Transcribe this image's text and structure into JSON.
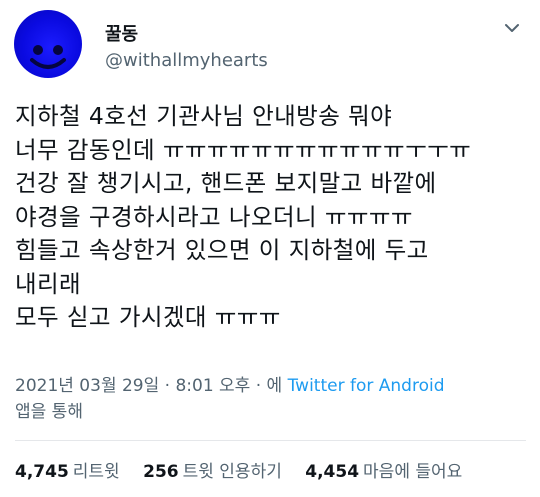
{
  "user": {
    "display_name": "꿀동",
    "handle": "@withallmyhearts"
  },
  "icons": {
    "avatar": "blue-smiley-avatar",
    "more": "chevron-down-icon"
  },
  "tweet": {
    "lines": [
      "지하철 4호선 기관사님  안내방송 뭐야",
      "너무 감동인데 ㅠㅠㅠㅠㅠㅠㅠㅠㅠㅠㅠㅜㅜㅠ",
      "건강 잘 챙기시고, 핸드폰 보지말고 바깥에",
      "야경을 구경하시라고 나오더니 ㅠㅠㅠㅠ",
      "힘들고 속상한거 있으면 이 지하철에 두고",
      "내리래",
      "모두 싣고  가시겠대 ㅠㅠㅠ"
    ]
  },
  "meta": {
    "timestamp": "2021년 03월 29일 · 8:01 오후 · 에 ",
    "source": "Twitter for Android",
    "via": "앱을 통해"
  },
  "stats": {
    "retweets_count": "4,745",
    "retweets_label": "리트윗",
    "quotes_count": "256",
    "quotes_label": "트윗 인용하기",
    "likes_count": "4,454",
    "likes_label": "마음에 들어요"
  },
  "colors": {
    "text": "#0f1419",
    "secondary": "#536471",
    "link": "#1d9bf0",
    "avatar_blue": "#0a0ae0"
  }
}
